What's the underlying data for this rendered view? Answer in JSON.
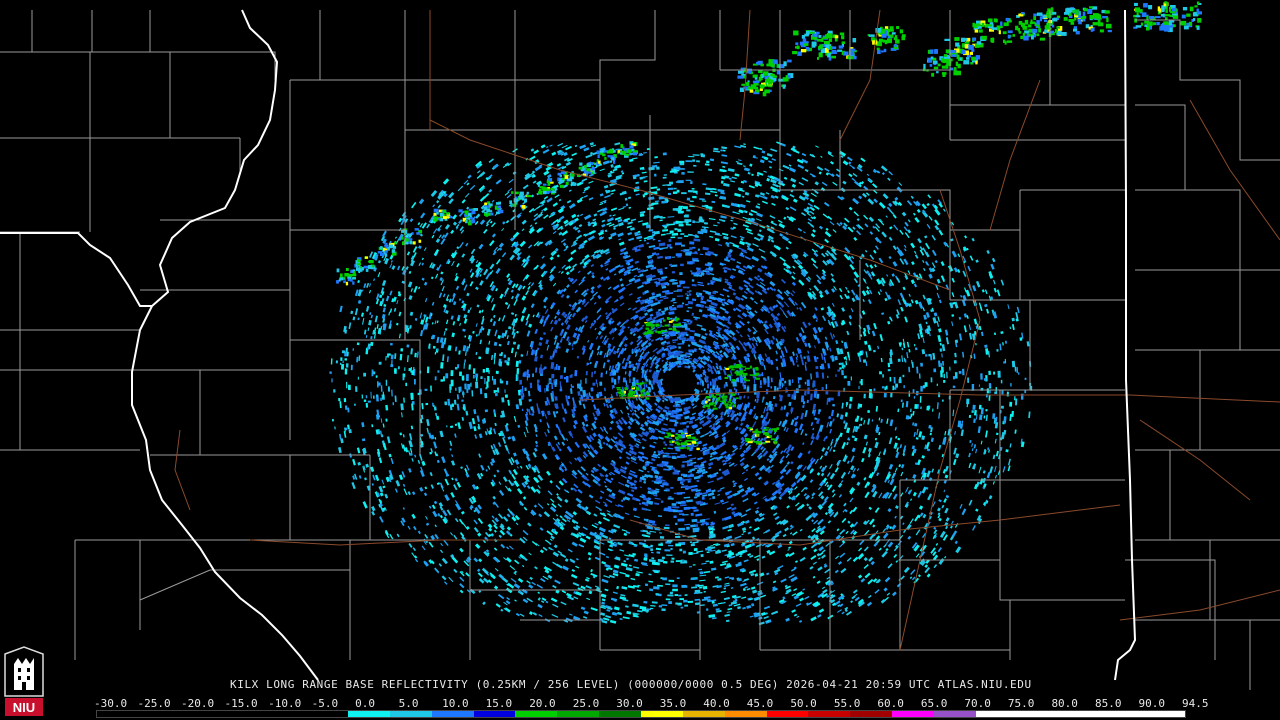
{
  "product": {
    "caption": "KILX LONG RANGE BASE REFLECTIVITY (0.25KM / 256 LEVEL) (000000/0000 0.5 DEG) 2026-04-21 20:59 UTC  ATLAS.NIU.EDU"
  },
  "logo": {
    "text": "NIU"
  },
  "scale": {
    "labels": [
      "-30.0",
      "-25.0",
      "-20.0",
      "-15.0",
      "-10.0",
      "-5.0",
      "0.0",
      "5.0",
      "10.0",
      "15.0",
      "20.0",
      "25.0",
      "30.0",
      "35.0",
      "40.0",
      "45.0",
      "50.0",
      "55.0",
      "60.0",
      "65.0",
      "70.0",
      "75.0",
      "80.0",
      "85.0",
      "90.0",
      "94.5"
    ],
    "colors": [
      "#000000",
      "#000000",
      "#000000",
      "#000000",
      "#000000",
      "#000000",
      "#0ff0f0",
      "#1ec8e6",
      "#1e78ff",
      "#0000e0",
      "#00d000",
      "#00a800",
      "#007800",
      "#ffff00",
      "#e6b400",
      "#ff8c00",
      "#ff0000",
      "#c80000",
      "#a00000",
      "#ff00ff",
      "#9650c8",
      "#ffffff",
      "#ffffff",
      "#ffffff",
      "#ffffff",
      "#ffffff"
    ]
  },
  "map_colors": {
    "background": "#000000",
    "county_lines": "#9a9a9a",
    "state_lines": "#ffffff",
    "roads": "#8b4a2b"
  }
}
